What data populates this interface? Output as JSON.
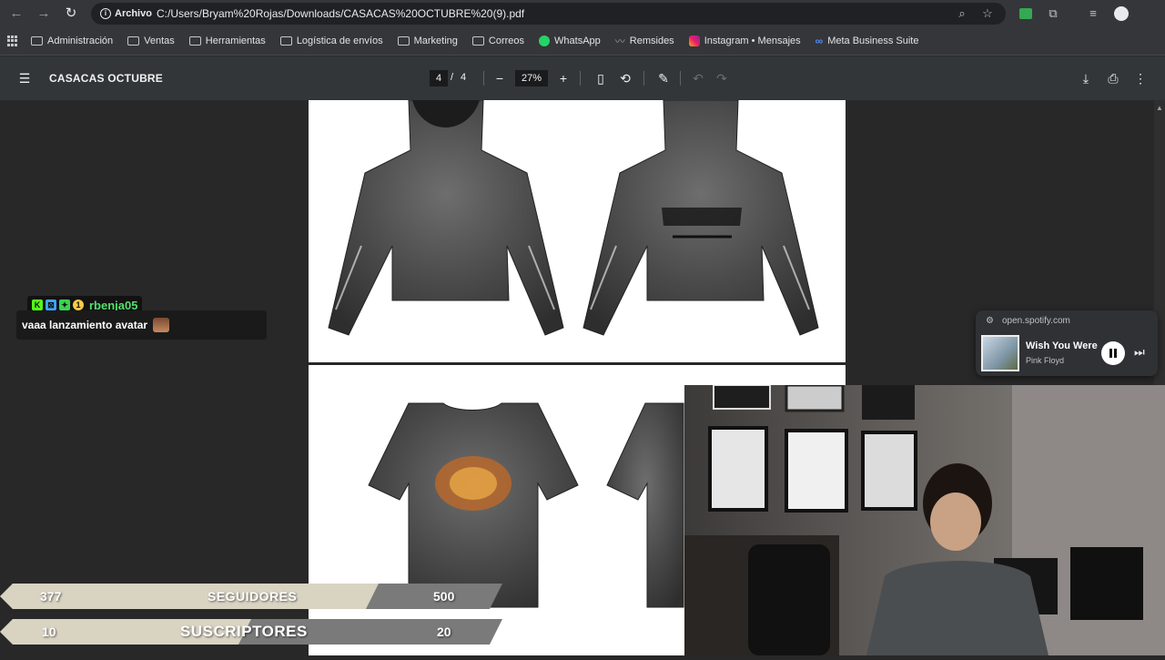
{
  "browser": {
    "origin_chip": "Archivo",
    "url": "C:/Users/Bryam%20Rojas/Downloads/CASACAS%20OCTUBRE%20(9).pdf",
    "icons": [
      "back-arrow",
      "forward-arrow",
      "reload",
      "zoom",
      "star",
      "extension",
      "puzzle",
      "reading-list",
      "profile"
    ]
  },
  "bookmarks": [
    {
      "label": "Administración",
      "icon": "folder"
    },
    {
      "label": "Ventas",
      "icon": "folder"
    },
    {
      "label": "Herramientas",
      "icon": "folder"
    },
    {
      "label": "Logística de envíos",
      "icon": "folder"
    },
    {
      "label": "Marketing",
      "icon": "folder"
    },
    {
      "label": "Correos",
      "icon": "folder"
    },
    {
      "label": "WhatsApp",
      "icon": "whatsapp"
    },
    {
      "label": "Remsides",
      "icon": "remsides"
    },
    {
      "label": "Instagram • Mensajes",
      "icon": "instagram"
    },
    {
      "label": "Meta Business Suite",
      "icon": "meta"
    }
  ],
  "pdf_toolbar": {
    "title": "CASACAS OCTUBRE",
    "page_current": "4",
    "page_sep": "/",
    "page_total": "4",
    "zoom": "27%",
    "icons": [
      "menu",
      "zoom-out",
      "zoom-in",
      "fit-page",
      "rotate",
      "annotate",
      "undo",
      "redo",
      "download",
      "print",
      "more"
    ]
  },
  "chat": {
    "username": "rbenja05",
    "badges": [
      "K",
      "⊠",
      "✦",
      "1"
    ],
    "message": "vaaa lanzamiento avatar"
  },
  "spotify": {
    "host": "open.spotify.com",
    "track": "Wish You Were Here",
    "artist": "Pink Floyd"
  },
  "stats": {
    "followers": {
      "current": "377",
      "label": "SEGUIDORES",
      "goal": "500"
    },
    "subscribers": {
      "current": "10",
      "label": "SUSCRIPTORES",
      "goal": "20"
    }
  },
  "colors": {
    "chrome_bar": "#35363a",
    "pdf_bar": "#323639",
    "viewer_bg": "#282828",
    "chat_name": "#52e06a",
    "stat_light": "#d9d3c2",
    "stat_dark": "#7a7a7a"
  }
}
